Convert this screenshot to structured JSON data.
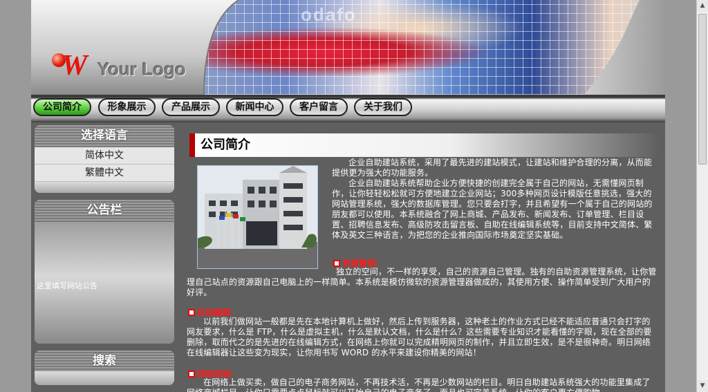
{
  "header": {
    "logo_text": "Your Logo",
    "banner_watermark": "odafo"
  },
  "nav": {
    "items": [
      {
        "label": "公司简介",
        "active": true
      },
      {
        "label": "形象展示",
        "active": false
      },
      {
        "label": "产品展示",
        "active": false
      },
      {
        "label": "新闻中心",
        "active": false
      },
      {
        "label": "客户留言",
        "active": false
      },
      {
        "label": "关于我们",
        "active": false
      }
    ]
  },
  "sidebar": {
    "language": {
      "title": "选择语言",
      "items": [
        "简体中文",
        "繁體中文"
      ]
    },
    "notice": {
      "title": "公告栏",
      "text": "这里填写网站公告"
    },
    "search": {
      "title": "搜索"
    }
  },
  "content": {
    "title": "公司简介",
    "intro_p1": "企业自助建站系统，采用了最先进的建站模式，让建站和维护合理的分离，从而能提供更为强大的功能服务。",
    "intro_p2": "企业自助建站系统帮助企业方便快捷的创建完全属于自己的网站，无需懂网页制作，让你轻轻松松就可方便地建立企业网站；300多种网页设计模版任意挑选，强大的网站管理系统，强大的数据库管理。您只要会打字，并且希望有一个属于自己的网站的朋友都可以使用。本系统融合了网上商城、产品发布、新闻发布、订单管理、栏目设置、招聘信息发布、高级防攻击留言板、自助在线编辑系统等，目前支持中文简体、繁体及英文三种语言，为把您的企业推向国际市场奠定坚实基础。",
    "sections": [
      {
        "heading": "资源管理：",
        "body": "独立的空间，不一样的享受，自己的资源自己管理。独有的自助资源管理系统，让你管理自己站点的资源跟自己电脑上的一样简单。本系统是模仿微软的资源管理器做成的，其使用方便、操作简单受到广大用户的好评。"
      },
      {
        "heading": "在线编辑：",
        "body": "以前我们做网站一般都是先在本地计算机上做好，然后上传到服务器，这种老土的作业方式已经不能适应普通只会打字的网友要求，什么是 FTP，什么是虚拟主机，什么是默认文档，什么是什么？这些需要专业知识才能看懂的字眼，现在全部的要删除，取而代之的是先进的在线编辑方式，在网络上你就可以完成精明网页的制作，并且立即生效，是不是很神奇。明日网络在线编辑器让这些变为现实，让你用书写 WORD 的水平来建设你精美的网站！"
      },
      {
        "heading": "网络商城：",
        "body": "在网络上做买卖，做自己的电子商务网站，不再技术活，不再是少数网站的栏目。明日自助建站系统强大的功能里集成了网络商城栏目，让你只需要点点鼠标就可以开始自己的电子商务了，而且也可完美系统，让你的客户更方便购物。"
      }
    ]
  },
  "colors": {
    "page_bg": "#9a9a9a",
    "content_bg": "#5f5f5f",
    "accent_red": "#b30000",
    "nav_active": "#5fcf3e",
    "section_heading": "#ff1a1a"
  }
}
